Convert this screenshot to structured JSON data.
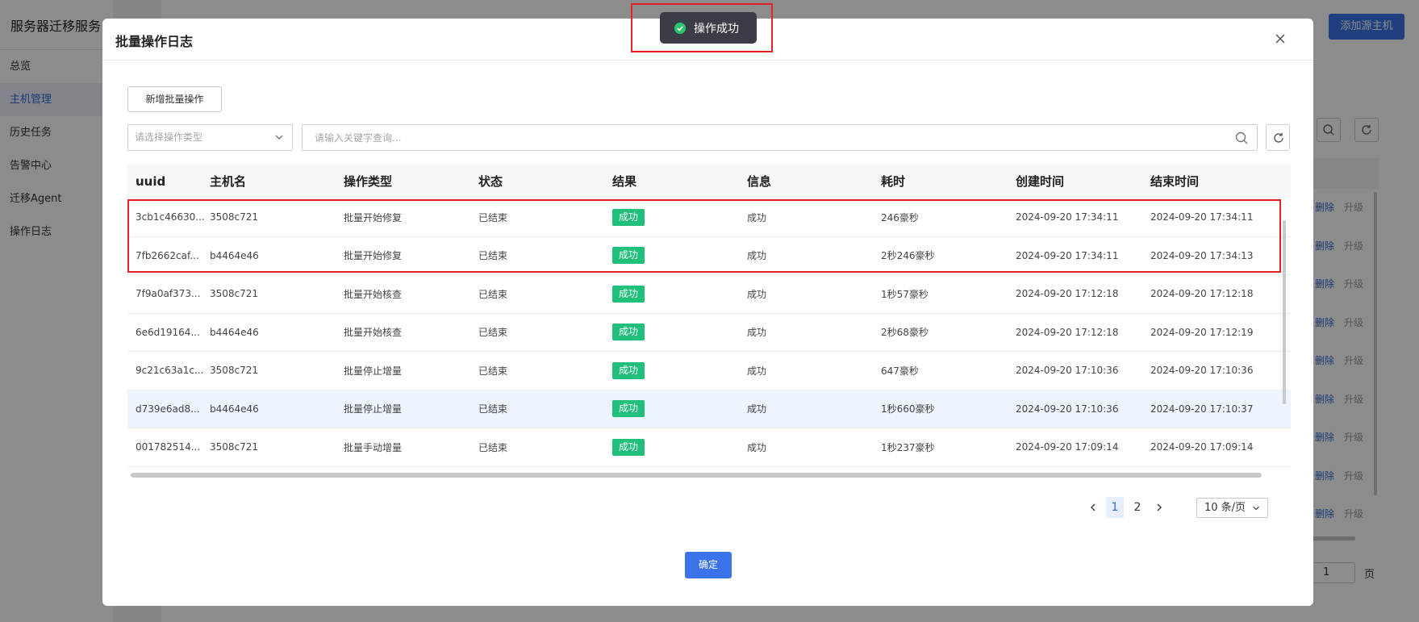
{
  "app": {
    "title": "服务器迁移服务",
    "nav": [
      "总览",
      "主机管理",
      "历史任务",
      "告警中心",
      "迁移Agent",
      "操作日志"
    ],
    "active_nav": 1,
    "add_source_host_label": "添加源主机",
    "row_actions": {
      "delete": "删除",
      "upgrade": "升级"
    },
    "page_input_value": "1",
    "page_unit": "页"
  },
  "toast": {
    "message": "操作成功",
    "status_color": "#2cc56f"
  },
  "modal": {
    "title": "批量操作日志",
    "new_batch_label": "新增批量操作",
    "type_select_placeholder": "请选择操作类型",
    "search_placeholder": "请输入关键字查询...",
    "confirm_label": "确定"
  },
  "table": {
    "columns": [
      "uuid",
      "主机名",
      "操作类型",
      "状态",
      "结果",
      "信息",
      "耗时",
      "创建时间",
      "结束时间"
    ],
    "rows": [
      {
        "uuid": "3cb1c46630...",
        "host": "3508c721",
        "op": "批量开始修复",
        "status": "已结束",
        "result": "成功",
        "info": "成功",
        "duration": "246豪秒",
        "created": "2024-09-20 17:34:11",
        "ended": "2024-09-20 17:34:11"
      },
      {
        "uuid": "7fb2662caf...",
        "host": "b4464e46",
        "op": "批量开始修复",
        "status": "已结束",
        "result": "成功",
        "info": "成功",
        "duration": "2秒246豪秒",
        "created": "2024-09-20 17:34:11",
        "ended": "2024-09-20 17:34:13"
      },
      {
        "uuid": "7f9a0af373...",
        "host": "3508c721",
        "op": "批量开始核查",
        "status": "已结束",
        "result": "成功",
        "info": "成功",
        "duration": "1秒57豪秒",
        "created": "2024-09-20 17:12:18",
        "ended": "2024-09-20 17:12:18"
      },
      {
        "uuid": "6e6d19164...",
        "host": "b4464e46",
        "op": "批量开始核查",
        "status": "已结束",
        "result": "成功",
        "info": "成功",
        "duration": "2秒68豪秒",
        "created": "2024-09-20 17:12:18",
        "ended": "2024-09-20 17:12:19"
      },
      {
        "uuid": "9c21c63a1c...",
        "host": "3508c721",
        "op": "批量停止增量",
        "status": "已结束",
        "result": "成功",
        "info": "成功",
        "duration": "647豪秒",
        "created": "2024-09-20 17:10:36",
        "ended": "2024-09-20 17:10:36"
      },
      {
        "uuid": "d739e6ad8...",
        "host": "b4464e46",
        "op": "批量停止增量",
        "status": "已结束",
        "result": "成功",
        "info": "成功",
        "duration": "1秒660豪秒",
        "created": "2024-09-20 17:10:36",
        "ended": "2024-09-20 17:10:37"
      },
      {
        "uuid": "001782514...",
        "host": "3508c721",
        "op": "批量手动增量",
        "status": "已结束",
        "result": "成功",
        "info": "成功",
        "duration": "1秒237豪秒",
        "created": "2024-09-20 17:09:14",
        "ended": "2024-09-20 17:09:14"
      }
    ],
    "highlighted_row": 5,
    "success_color": "#20c07a"
  },
  "pagination": {
    "pages": [
      "1",
      "2"
    ],
    "current": "1",
    "page_size": "10 条/页"
  },
  "colors": {
    "primary": "#3a73ea",
    "annotation_red": "#e02424"
  }
}
